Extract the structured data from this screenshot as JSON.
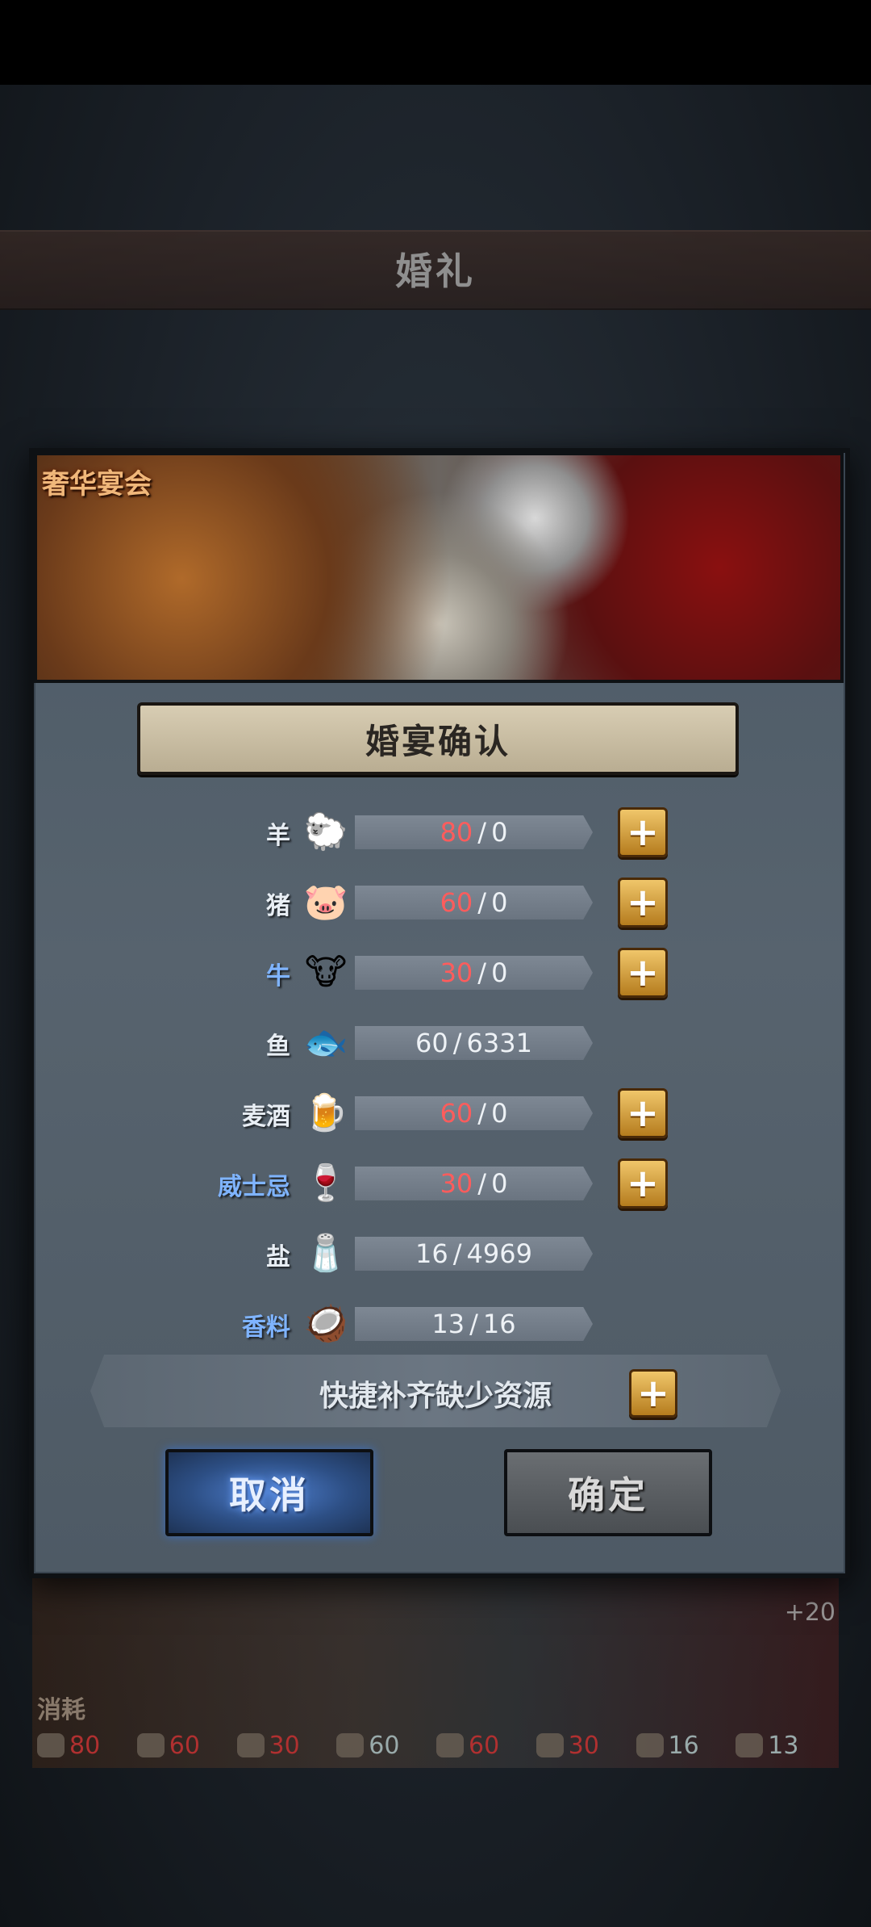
{
  "background": {
    "page_title": "婚礼",
    "card_gain": "+20",
    "consume_label": "消耗",
    "consume_items": [
      {
        "icon": "sheep-icon",
        "value": "80",
        "short": true
      },
      {
        "icon": "pig-icon",
        "value": "60",
        "short": true
      },
      {
        "icon": "cow-icon",
        "value": "30",
        "short": true
      },
      {
        "icon": "fish-icon",
        "value": "60",
        "short": false
      },
      {
        "icon": "beer-icon",
        "value": "60",
        "short": true
      },
      {
        "icon": "whisky-icon",
        "value": "30",
        "short": true
      },
      {
        "icon": "salt-icon",
        "value": "16",
        "short": false
      },
      {
        "icon": "spice-icon",
        "value": "13",
        "short": false
      }
    ]
  },
  "dialog": {
    "banner_label": "奢华宴会",
    "title": "婚宴确认",
    "resources": [
      {
        "label": "羊",
        "icon": "sheep-icon",
        "need": "80",
        "have": "0",
        "short": true,
        "blue": false
      },
      {
        "label": "猪",
        "icon": "pig-icon",
        "need": "60",
        "have": "0",
        "short": true,
        "blue": false
      },
      {
        "label": "牛",
        "icon": "cow-icon",
        "need": "30",
        "have": "0",
        "short": true,
        "blue": true
      },
      {
        "label": "鱼",
        "icon": "fish-icon",
        "need": "60",
        "have": "6331",
        "short": false,
        "blue": false
      },
      {
        "label": "麦酒",
        "icon": "beer-icon",
        "need": "60",
        "have": "0",
        "short": true,
        "blue": false
      },
      {
        "label": "威士忌",
        "icon": "whisky-icon",
        "need": "30",
        "have": "0",
        "short": true,
        "blue": true
      },
      {
        "label": "盐",
        "icon": "salt-icon",
        "need": "16",
        "have": "4969",
        "short": false,
        "blue": false
      },
      {
        "label": "香料",
        "icon": "spice-icon",
        "need": "13",
        "have": "16",
        "short": false,
        "blue": true
      }
    ],
    "separator": "/",
    "plus_symbol": "+",
    "quick_fill_label": "快捷补齐缺少资源",
    "cancel_label": "取消",
    "confirm_label": "确定"
  }
}
